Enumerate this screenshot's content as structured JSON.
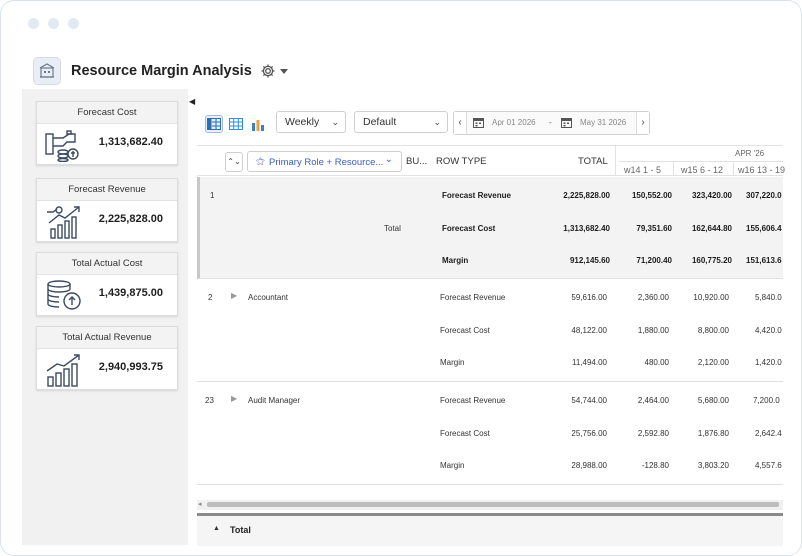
{
  "app": {
    "title": "Resource Margin Analysis",
    "icon": "building-icon"
  },
  "cards": [
    {
      "label": "Forecast Cost",
      "value": "1,313,682.40",
      "icon": "money-hand-icon"
    },
    {
      "label": "Forecast Revenue",
      "value": "2,225,828.00",
      "icon": "revenue-growth-icon"
    },
    {
      "label": "Total Actual Cost",
      "value": "1,439,875.00",
      "icon": "coin-stack-icon"
    },
    {
      "label": "Total Actual Revenue",
      "value": "2,940,993.75",
      "icon": "bar-chart-growth-icon"
    }
  ],
  "toolbar": {
    "period": "Weekly",
    "view": "Default",
    "date_from": "Apr 01 2026",
    "date_sep": "-",
    "date_to": "May 31 2026"
  },
  "grid": {
    "headers": {
      "group_by": "Primary Role + Resource...",
      "bu": "BU...",
      "row_type": "ROW TYPE",
      "total": "TOTAL",
      "month": "APR '26",
      "weeks": [
        "w14 1 - 5",
        "w15 6 - 12",
        "w16 13 - 19"
      ]
    },
    "groups": [
      {
        "num": "1",
        "name": "",
        "bu": "Total",
        "rows": [
          {
            "type": "Forecast Revenue",
            "total": "2,225,828.00",
            "w": [
              "150,552.00",
              "323,420.00",
              "307,220.0"
            ]
          },
          {
            "type": "Forecast Cost",
            "total": "1,313,682.40",
            "w": [
              "79,351.60",
              "162,644.80",
              "155,606.4"
            ]
          },
          {
            "type": "Margin",
            "total": "912,145.60",
            "w": [
              "71,200.40",
              "160,775.20",
              "151,613.6"
            ]
          }
        ]
      },
      {
        "num": "2",
        "name": "Accountant",
        "bu": "",
        "rows": [
          {
            "type": "Forecast Revenue",
            "total": "59,616.00",
            "w": [
              "2,360.00",
              "10,920.00",
              "5,840.0"
            ]
          },
          {
            "type": "Forecast Cost",
            "total": "48,122.00",
            "w": [
              "1,880.00",
              "8,800.00",
              "4,420.0"
            ]
          },
          {
            "type": "Margin",
            "total": "11,494.00",
            "w": [
              "480.00",
              "2,120.00",
              "1,420.0"
            ]
          }
        ]
      },
      {
        "num": "23",
        "name": "Audit Manager",
        "bu": "",
        "rows": [
          {
            "type": "Forecast Revenue",
            "total": "54,744.00",
            "w": [
              "2,464.00",
              "5,680.00",
              "7,200.0"
            ]
          },
          {
            "type": "Forecast Cost",
            "total": "25,756.00",
            "w": [
              "2,592.80",
              "1,876.80",
              "2,642.4"
            ]
          },
          {
            "type": "Margin",
            "total": "28,988.00",
            "w": [
              "-128.80",
              "3,803.20",
              "4,557.6"
            ]
          }
        ]
      }
    ],
    "footer_label": "Total"
  }
}
